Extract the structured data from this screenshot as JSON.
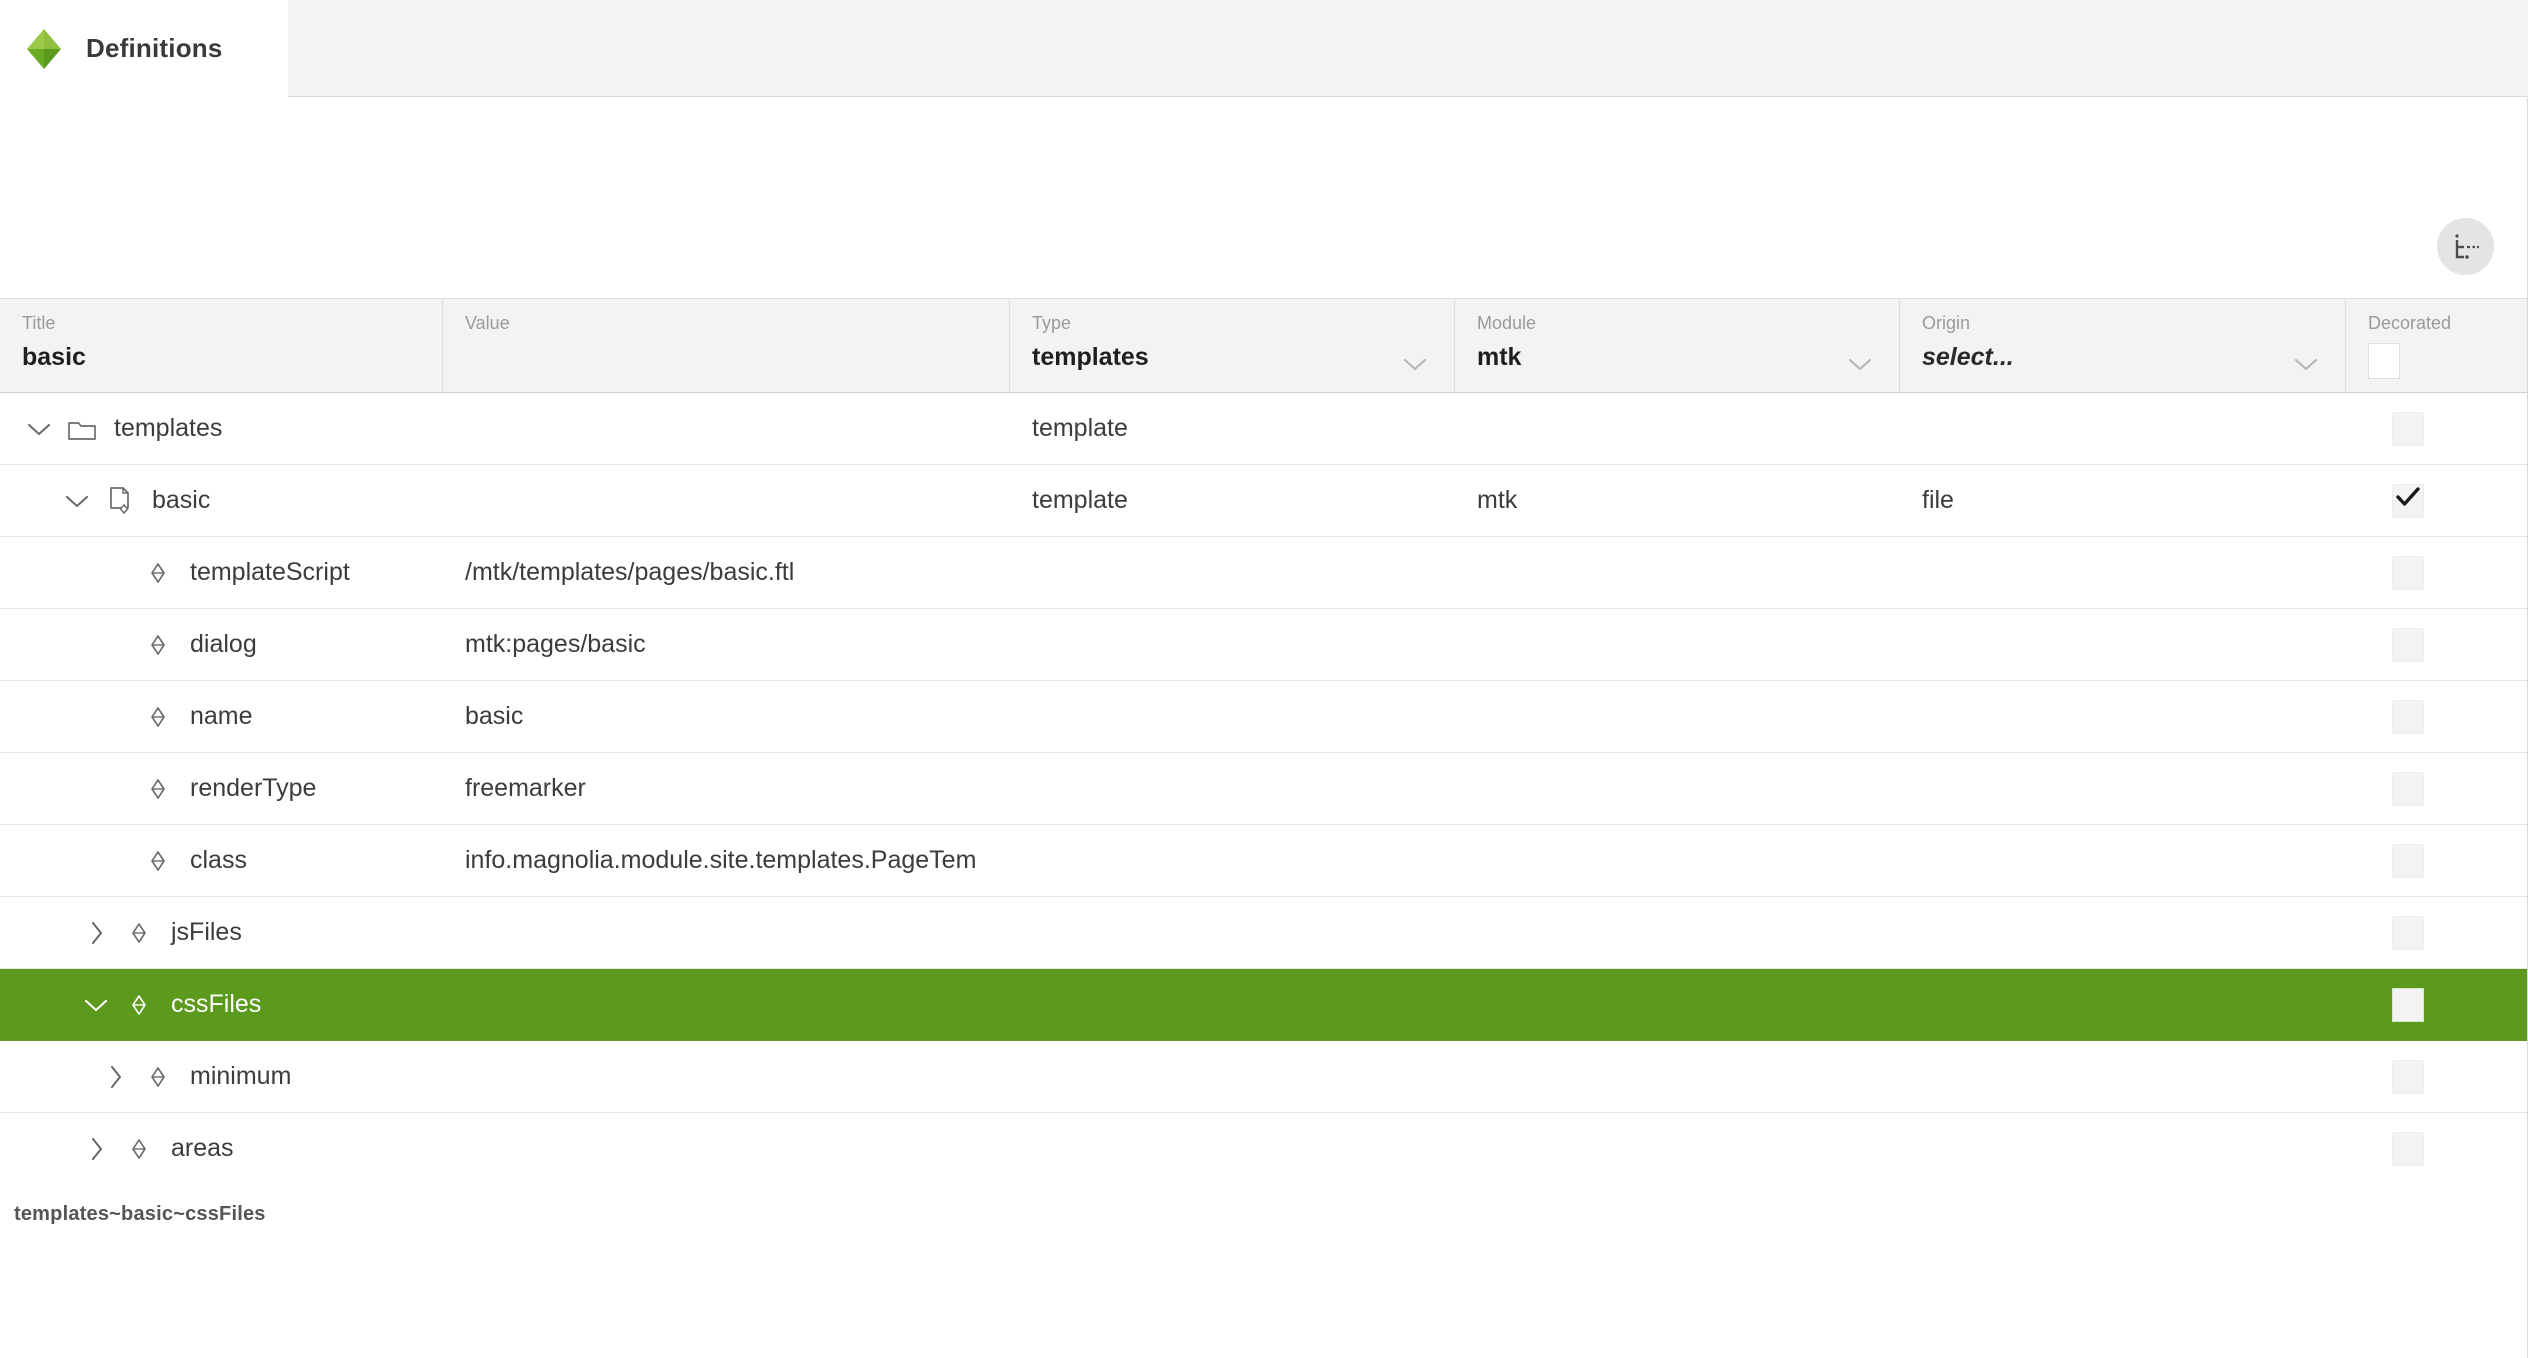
{
  "tab": {
    "label": "Definitions",
    "logo_icon": "magnolia-diamond-logo",
    "logo_color_top": "#8fc13e",
    "logo_color_bottom": "#5c9a1e"
  },
  "toolbar": {
    "tree_toggle_icon": "tree-hierarchy-icon",
    "tree_toggle_title": "Toggle tree view"
  },
  "table": {
    "columns": [
      {
        "key": "title",
        "label": "Title",
        "filter_value": "basic",
        "filter_type": "text",
        "has_chevron": false,
        "has_checkbox": false
      },
      {
        "key": "value",
        "label": "Value",
        "filter_value": "",
        "filter_type": "text",
        "has_chevron": false,
        "has_checkbox": false
      },
      {
        "key": "type",
        "label": "Type",
        "filter_value": "templates",
        "filter_type": "select",
        "has_chevron": true,
        "has_checkbox": false
      },
      {
        "key": "module",
        "label": "Module",
        "filter_value": "mtk",
        "filter_type": "select",
        "has_chevron": true,
        "has_checkbox": false
      },
      {
        "key": "origin",
        "label": "Origin",
        "filter_value": "select...",
        "filter_type": "select",
        "has_chevron": true,
        "has_checkbox": false,
        "is_placeholder": true
      },
      {
        "key": "decorated",
        "label": "Decorated",
        "filter_value": "",
        "filter_type": "checkbox",
        "has_chevron": false,
        "has_checkbox": true
      }
    ],
    "rows": [
      {
        "title": "templates",
        "value": "",
        "type": "template",
        "module": "",
        "origin": "",
        "decorated": false,
        "indent": 0,
        "expander": "chevron-down-icon",
        "icon": "folder-icon",
        "selected": false
      },
      {
        "title": "basic",
        "value": "",
        "type": "template",
        "module": "mtk",
        "origin": "file",
        "decorated": true,
        "indent": 1,
        "expander": "chevron-down-icon",
        "icon": "definition-file-icon",
        "selected": false
      },
      {
        "title": "templateScript",
        "value": "/mtk/templates/pages/basic.ftl",
        "type": "",
        "module": "",
        "origin": "",
        "decorated": false,
        "indent": 2,
        "expander": "none",
        "icon": "property-diamond-icon",
        "selected": false
      },
      {
        "title": "dialog",
        "value": "mtk:pages/basic",
        "type": "",
        "module": "",
        "origin": "",
        "decorated": false,
        "indent": 2,
        "expander": "none",
        "icon": "property-diamond-icon",
        "selected": false
      },
      {
        "title": "name",
        "value": "basic",
        "type": "",
        "module": "",
        "origin": "",
        "decorated": false,
        "indent": 2,
        "expander": "none",
        "icon": "property-diamond-icon",
        "selected": false
      },
      {
        "title": "renderType",
        "value": "freemarker",
        "type": "",
        "module": "",
        "origin": "",
        "decorated": false,
        "indent": 2,
        "expander": "none",
        "icon": "property-diamond-icon",
        "selected": false
      },
      {
        "title": "class",
        "value": "info.magnolia.module.site.templates.PageTem",
        "type": "",
        "module": "",
        "origin": "",
        "decorated": false,
        "indent": 2,
        "expander": "none",
        "icon": "property-diamond-icon",
        "selected": false
      },
      {
        "title": "jsFiles",
        "value": "",
        "type": "",
        "module": "",
        "origin": "",
        "decorated": false,
        "indent": 1.5,
        "expander": "chevron-right-icon",
        "icon": "property-diamond-icon",
        "selected": false
      },
      {
        "title": "cssFiles",
        "value": "",
        "type": "",
        "module": "",
        "origin": "",
        "decorated": false,
        "indent": 1.5,
        "expander": "chevron-down-icon",
        "icon": "property-diamond-icon",
        "selected": true
      },
      {
        "title": "minimum",
        "value": "",
        "type": "",
        "module": "",
        "origin": "",
        "decorated": false,
        "indent": 2,
        "expander": "chevron-right-icon",
        "icon": "property-diamond-icon",
        "selected": false
      },
      {
        "title": "areas",
        "value": "",
        "type": "",
        "module": "",
        "origin": "",
        "decorated": false,
        "indent": 1.5,
        "expander": "chevron-right-icon",
        "icon": "property-diamond-icon",
        "selected": false
      }
    ]
  },
  "statusbar": {
    "path": "templates~basic~cssFiles"
  },
  "colors": {
    "selection_green": "#5c9a1e",
    "logo_green_light": "#8fc13e",
    "header_bg": "#f3f3f3",
    "border": "#dcdcdc"
  }
}
